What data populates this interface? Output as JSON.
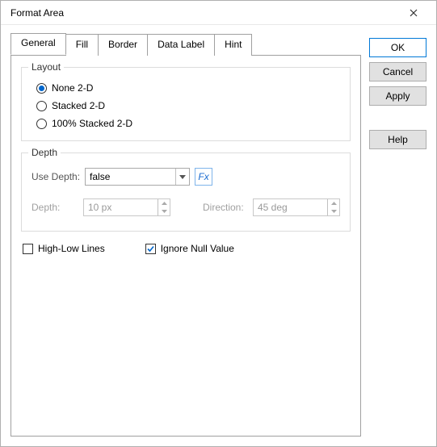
{
  "title": "Format Area",
  "tabs": {
    "general": "General",
    "fill": "Fill",
    "border": "Border",
    "data_label": "Data Label",
    "hint": "Hint"
  },
  "buttons": {
    "ok": "OK",
    "cancel": "Cancel",
    "apply": "Apply",
    "help": "Help"
  },
  "layout": {
    "legend": "Layout",
    "none": "None 2-D",
    "stacked": "Stacked 2-D",
    "hundred": "100% Stacked 2-D"
  },
  "depth": {
    "legend": "Depth",
    "use_depth_label": "Use Depth:",
    "use_depth_value": "false",
    "fx": "Fx",
    "depth_label": "Depth:",
    "depth_value": "10 px",
    "direction_label": "Direction:",
    "direction_value": "45 deg"
  },
  "checks": {
    "highlow": "High-Low Lines",
    "ignore_null": "Ignore Null Value"
  }
}
